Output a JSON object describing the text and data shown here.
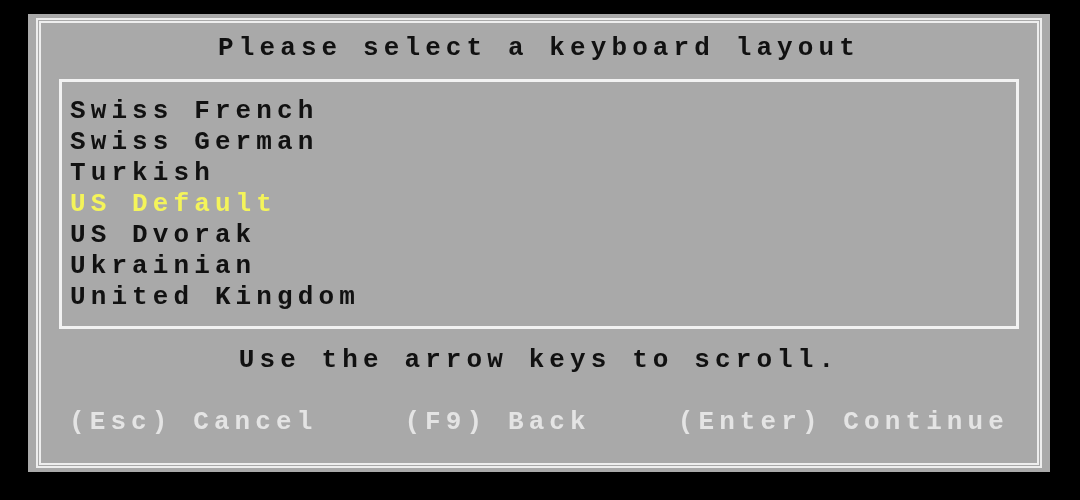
{
  "dialog": {
    "title": "Please select a keyboard layout",
    "layouts": [
      {
        "label": "Swiss French",
        "selected": false
      },
      {
        "label": "Swiss German",
        "selected": false
      },
      {
        "label": "Turkish",
        "selected": false
      },
      {
        "label": "US Default",
        "selected": true
      },
      {
        "label": "US Dvorak",
        "selected": false
      },
      {
        "label": "Ukrainian",
        "selected": false
      },
      {
        "label": "United Kingdom",
        "selected": false
      }
    ],
    "hint": "Use the arrow keys to scroll.",
    "actions": [
      "(Esc) Cancel",
      "(F9) Back",
      "(Enter) Continue"
    ]
  }
}
